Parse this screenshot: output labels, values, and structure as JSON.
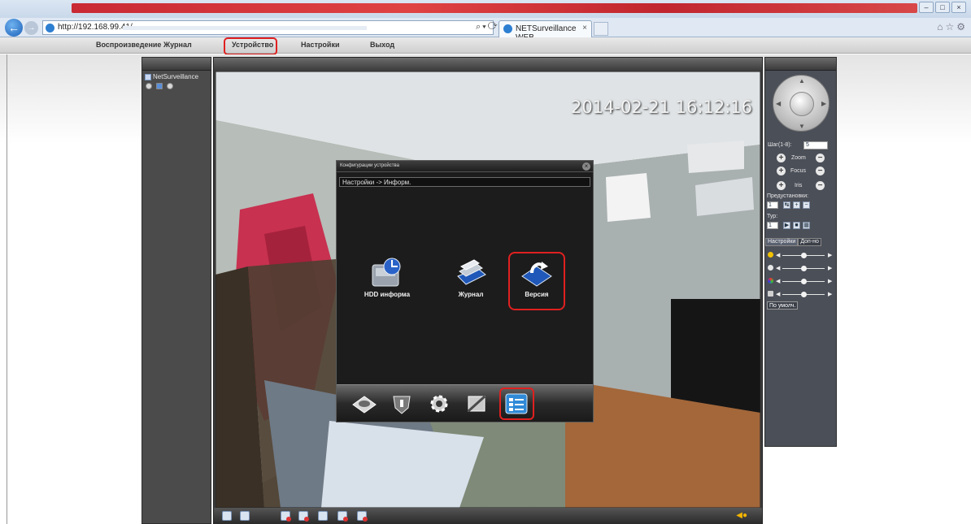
{
  "browser": {
    "url": "http://192.168.99.41/",
    "tab_title": "NETSurveillance WEB",
    "tab_close": "×"
  },
  "menu": {
    "items": [
      "Воспроизведение",
      "Журнал",
      "Устройство",
      "Настройки",
      "Выход"
    ],
    "highlighted": "Устройство"
  },
  "device_tree": {
    "root_label": "NetSurveillance"
  },
  "video": {
    "osd_timestamp": "2014-02-21 16:12:16"
  },
  "config_dialog": {
    "title": "Конфигурации устройства",
    "breadcrumb": "Настройки -> Информ.",
    "items": [
      {
        "label": "HDD информа",
        "icon": "hdd-info-icon"
      },
      {
        "label": "Журнал",
        "icon": "log-icon"
      },
      {
        "label": "Версия",
        "icon": "version-icon"
      }
    ],
    "highlighted_item": "Версия",
    "bottom_tabs": [
      "record-config-icon",
      "alarm-icon",
      "system-settings-icon",
      "advanced-tools-icon",
      "info-icon"
    ],
    "active_bottom_tab": "info-icon"
  },
  "ptz": {
    "step_label": "Шаг(1-8):",
    "step_value": "5",
    "zoom_label": "Zoom",
    "focus_label": "Focus",
    "iris_label": "Iris",
    "presets_label": "Предустановки:",
    "preset_value": "1",
    "tour_label": "Тур:",
    "tour_value": "1",
    "tabs": [
      "Настройки",
      "Доп-но"
    ],
    "default_button": "По умолч."
  },
  "colors": {
    "highlight": "#e02020",
    "panel_dark": "#4b4b4b",
    "dialog_bg": "#1c1c1c"
  }
}
